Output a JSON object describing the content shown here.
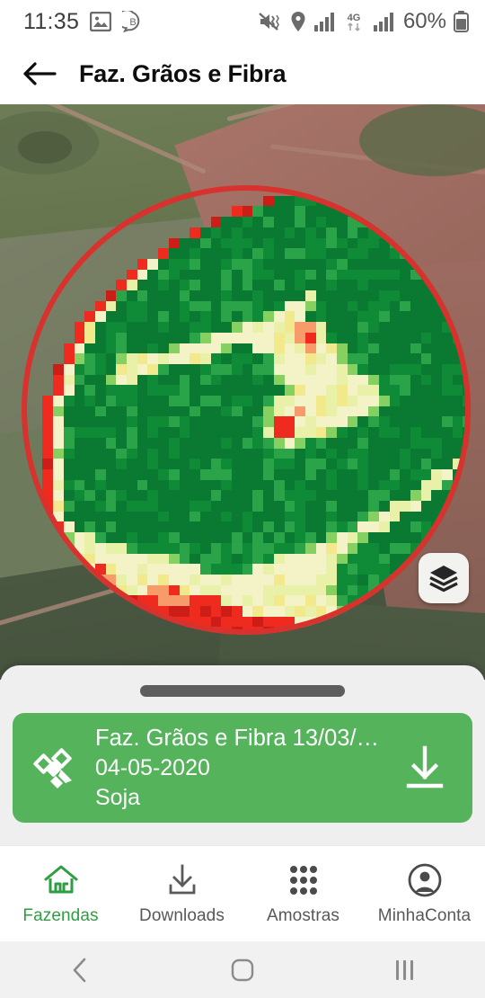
{
  "status_bar": {
    "time": "11:35",
    "battery_percent": "60%",
    "network": "4G",
    "icons": [
      "photo-icon",
      "bixby-icon",
      "mute-vibrate-icon",
      "location-pin-icon",
      "signal-bars-icon",
      "network-4g-icon",
      "signal-bars-2-icon",
      "battery-icon"
    ]
  },
  "app_bar": {
    "back_icon": "back-arrow-icon",
    "title": "Faz. Grãos e Fibra"
  },
  "map": {
    "layers_button_icon": "layers-icon",
    "overlay_type": "NDVI raster",
    "field_shape": "center-pivot circle"
  },
  "sheet": {
    "handle": "drag-handle",
    "card": {
      "icon": "satellite-icon",
      "title": "Faz. Grãos e Fibra 13/03/…",
      "date": "04-05-2020",
      "crop": "Soja",
      "action_icon": "download-icon",
      "color": "#54b35b"
    }
  },
  "bottom_nav": {
    "active_color": "#2e9e42",
    "inactive_color": "#585858",
    "items": [
      {
        "label": "Fazendas",
        "icon": "home-icon",
        "active": true
      },
      {
        "label": "Downloads",
        "icon": "download-icon",
        "active": false
      },
      {
        "label": "Amostras",
        "icon": "grid-dots-icon",
        "active": false
      },
      {
        "label": "MinhaConta",
        "icon": "account-icon",
        "active": false
      }
    ]
  },
  "system_nav": {
    "back": "system-back-icon",
    "home": "system-home-icon",
    "recents": "system-recents-icon"
  },
  "ndvi": {
    "palette": {
      "dark_green": "#0a7a32",
      "green": "#0f8a36",
      "mid_green": "#2ba349",
      "light_green": "#86cf61",
      "pale": "#e9f0a8",
      "cream": "#f4f3c8",
      "yellow": "#f2e98c",
      "orange": "#f79b6a",
      "red": "#ef2b20",
      "dark_red": "#cc1d16"
    },
    "cell_size": 11.7,
    "rows": [
      "...........................DDddG..............",
      ".......................dDGGGGGGGdD............",
      "....................RdGGGGGGGGGGGGGd..........",
      "..................dGGGGGGGGGGGGGGGGGGd........",
      "................RGGGGGGGGGGGGGGGGGGGGGd.......",
      "..............dGGGGGGGGGGGGGGGGGGGGGGGGd......",
      ".............RGGGGGGGGGGGGGGGGGGGGGGGGGGR.....",
      "...........RcGGGGGGGGGGGGGGGGGGGGGGGGGGGGd....",
      "..........RcGGGGGGGGGGGGGGGGGGGGGGGGGGGGGGR...",
      ".........RpGGGGGGGGGGGGGGGGGGGGGGGGGGGGGGGGR..",
      "........RpGGGGGGGGGGGGGGGGGpGGGGGGGGGGGGGGGd..",
      ".......RpGGGGGGGGGGGGGGGGccpGGGGGGGGGGGGGGGGR.",
      "......RcGGGGGGGGGGGGGGGpcccGGGGGGGGGGGGGGGGGR.",
      ".....RcGGGGGGGGGGGGGpcccccOOpGGGGGGGGGGGGGGGGR",
      ".....RcGGGGGGGGGGpccccccccOOcGGGGGGGGGGGGGGGGd",
      "....RcGGGGGGGGpccccpGGcccccOccpGGGGGGGGGGGGGGR",
      "....RpGGGpcccccccpGGGGGpccccccpGGGGGGGGGGGGGGR",
      "...RcGGGGccccpGGGGGGGGGpcccccccpGGGGGGGGGGGGGd",
      "...RpGGGpcpGGGGGGGGGGGGGpccccccccpGGGGGGGGGGGR",
      "...RcGGGGGGGGGGGGGGGGGGGGpcccccccpGGGGGGGGGGGR",
      "..RcGGGGGGGGGGGGGGGGGGGpccccccccccpGGGGGGGGGGR",
      "..RpGGGGGGGGGGGGGGGGGGGpccOccccccpGGGGGGGGGGGd",
      "..RcGGGGGGGGGGGGGGGGGGGpRRcccccpGGGGGGGGGGGGGR",
      "..RcGGGGGGGGGGGGGGGGGGGpRRcccpGGGGGGGGGGGGGGpR",
      "..RcGGGGGGGGGGGGGGGGGGGGpcpGGGGGGGGGGGGGGGGcpR",
      "..RpGGGGGGGGGGGGGGGGGGGGGGGGGGGGGGGGGGGGGGpRR",
      "..RcGGGGGGGGGGGGGGGGGGGGGGGGGGGGGGGGGGGGGpRRR",
      "..RcGGGGGGGGGGGGGGGGGGGGGGGGGGGGGGGGGGGpcGGpR",
      "..RpGGGGGGGGGGGGGGGGGGGGGGGGGGGGGGGGGGpcGGGGR",
      "..RcGGGGGGGGGGGGGGGGGGGGGGGGGGGGGGGGGpcGGGGGR",
      "..RcGGGGGGGGGGGGGGGGGGGGGGGGGGGGGGGpccGGGGGGd",
      "..RcGGGGGGGGGGGGGGGGGGGGGGGGGGGGGpccGGGGGGGGR",
      "...RcGGGGGGGGGGGGGGGGGGGGGGGGGGpccpGGGGGGGGR.",
      "...RpccpGGGGGGGGGGGGGGGGGGGGGpccpGGGGGGGGGGR.",
      "...RpccccpgggggggggggggggggpcccpgggggggggggR..",
      "....RcccccccccpgggggggggpcccccpggggggggggR....",
      "....RccOcccccccccpgggpcccccccpgggggggggggR....",
      ".....RcOOccccccccccccccccccccpgggggggggR......",
      ".....RRRRcccOOOccccccccccccccpgggggggggR......",
      "......RRRRRRROOORRRccccccccccpgggggggR........",
      ".......RRRRRRRRRRRRRRcccccccccpgggggR.........",
      "........RRRRRRRRRRRRRRRRRRcccccpgggR..........",
      ".........RRRRRRRRRRRRRRRRRRRRRcpgR............",
      "...........RRRRRRRRRRRRRRRRRRRRR..............",
      ".............RRRRRRRRRRRRRRRR.................",
      "................RRRRRRRRR....................."
    ]
  }
}
